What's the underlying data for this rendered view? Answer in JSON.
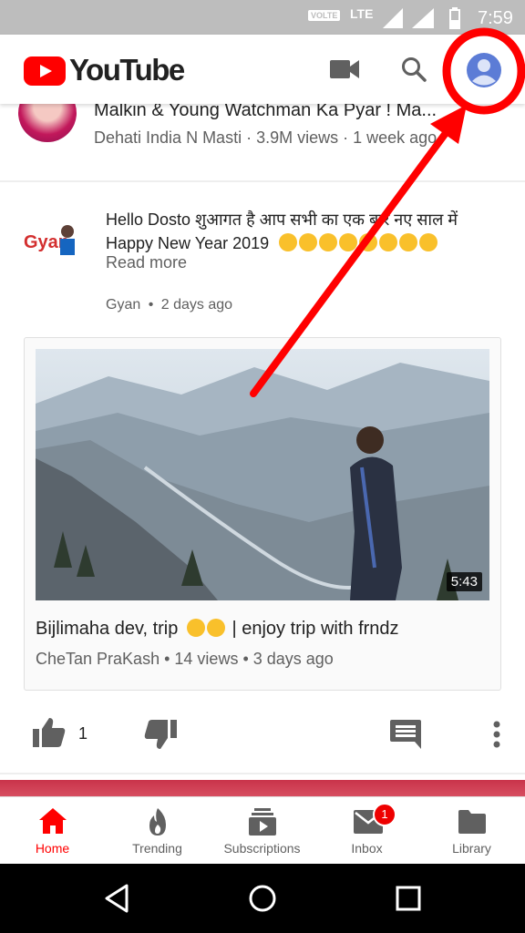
{
  "status_bar": {
    "volte": "VOLTE",
    "network": "LTE",
    "time": "7:59"
  },
  "app_bar": {
    "logo_text": "YouTube",
    "icons": [
      "video-camera-icon",
      "search-icon",
      "account-icon"
    ]
  },
  "previous_video": {
    "title": "Malkin & Young Watchman Ka Pyar ! Ma...",
    "meta": "Dehati India N Masti · 3.9M views · 1 week ago"
  },
  "post": {
    "text_line1": "Hello Dosto शुआगत है आप सभी का एक बार नए साल में",
    "text_line2": "Happy New Year 2019",
    "read_more": "Read more",
    "channel": "Gyan",
    "separator": "•",
    "age": "2 days ago",
    "avatar_text": "Gyan"
  },
  "video_card": {
    "duration": "5:43",
    "title_part1": "Bijlimaha dev, trip",
    "title_part2": " | enjoy trip with frndz",
    "channel": "CheTan PraKash",
    "views": "14 views",
    "age": "3 days ago",
    "sep": " • "
  },
  "actions": {
    "like_count": "1"
  },
  "bottom_nav": {
    "items": [
      {
        "label": "Home",
        "icon": "home-icon",
        "active": true
      },
      {
        "label": "Trending",
        "icon": "flame-icon"
      },
      {
        "label": "Subscriptions",
        "icon": "subscriptions-icon"
      },
      {
        "label": "Inbox",
        "icon": "mail-icon",
        "badge": "1"
      },
      {
        "label": "Library",
        "icon": "folder-icon"
      }
    ]
  },
  "colors": {
    "brand_red": "#ff0000",
    "annotation_red": "#ff0000",
    "text_secondary": "#606060"
  }
}
